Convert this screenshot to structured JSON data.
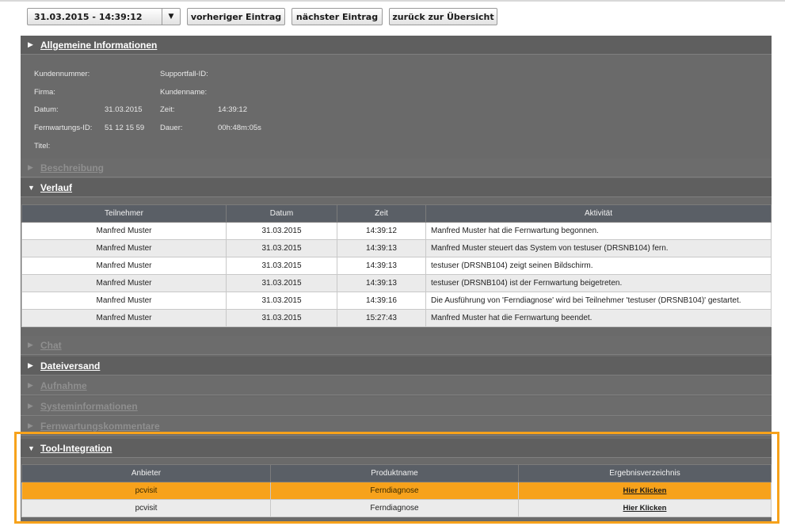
{
  "toolbar": {
    "entry_select": "31.03.2015 - 14:39:12",
    "prev_label": "vorheriger Eintrag",
    "next_label": "nächster Eintrag",
    "back_label": "zurück zur Übersicht"
  },
  "general": {
    "title": "Allgemeine Informationen",
    "fields": {
      "kundennummer_label": "Kundennummer:",
      "supportfall_label": "Supportfall-ID:",
      "firma_label": "Firma:",
      "kundenname_label": "Kundenname:",
      "datum_label": "Datum:",
      "datum_value": "31.03.2015",
      "zeit_label": "Zeit:",
      "zeit_value": "14:39:12",
      "fernwartung_label": "Fernwartungs-ID:",
      "fernwartung_value": "51 12 15 59",
      "dauer_label": "Dauer:",
      "dauer_value": "00h:48m:05s",
      "titel_label": "Titel:"
    }
  },
  "sections": {
    "beschreibung": "Beschreibung",
    "verlauf": "Verlauf",
    "chat": "Chat",
    "dateiversand": "Dateiversand",
    "aufnahme": "Aufnahme",
    "systeminformationen": "Systeminformationen",
    "kommentare": "Fernwartungskommentare",
    "tool": "Tool-Integration"
  },
  "verlauf_table": {
    "headers": [
      "Teilnehmer",
      "Datum",
      "Zeit",
      "Aktivität"
    ],
    "rows": [
      [
        "Manfred Muster",
        "31.03.2015",
        "14:39:12",
        "Manfred Muster hat die Fernwartung begonnen."
      ],
      [
        "Manfred Muster",
        "31.03.2015",
        "14:39:13",
        "Manfred Muster steuert das System von testuser (DRSNB104) fern."
      ],
      [
        "Manfred Muster",
        "31.03.2015",
        "14:39:13",
        "testuser (DRSNB104) zeigt seinen Bildschirm."
      ],
      [
        "Manfred Muster",
        "31.03.2015",
        "14:39:13",
        "testuser (DRSNB104) ist der Fernwartung beigetreten."
      ],
      [
        "Manfred Muster",
        "31.03.2015",
        "14:39:16",
        "Die Ausführung von 'Ferndiagnose' wird bei Teilnehmer 'testuser (DRSNB104)' gestartet."
      ],
      [
        "Manfred Muster",
        "31.03.2015",
        "15:27:43",
        "Manfred Muster hat die Fernwartung beendet."
      ]
    ]
  },
  "tool_table": {
    "headers": [
      "Anbieter",
      "Produktname",
      "Ergebnisverzeichnis"
    ],
    "rows": [
      [
        "pcvisit",
        "Ferndiagnose",
        "Hier Klicken"
      ],
      [
        "pcvisit",
        "Ferndiagnose",
        "Hier Klicken"
      ]
    ]
  },
  "colors": {
    "highlight": "#f7a21b",
    "panel": "#6a6a6a",
    "table_header": "#5a5f66"
  },
  "icons": {
    "expanded": "triangle-down-icon",
    "collapsed": "triangle-right-icon",
    "dropdown": "caret-down-icon"
  }
}
